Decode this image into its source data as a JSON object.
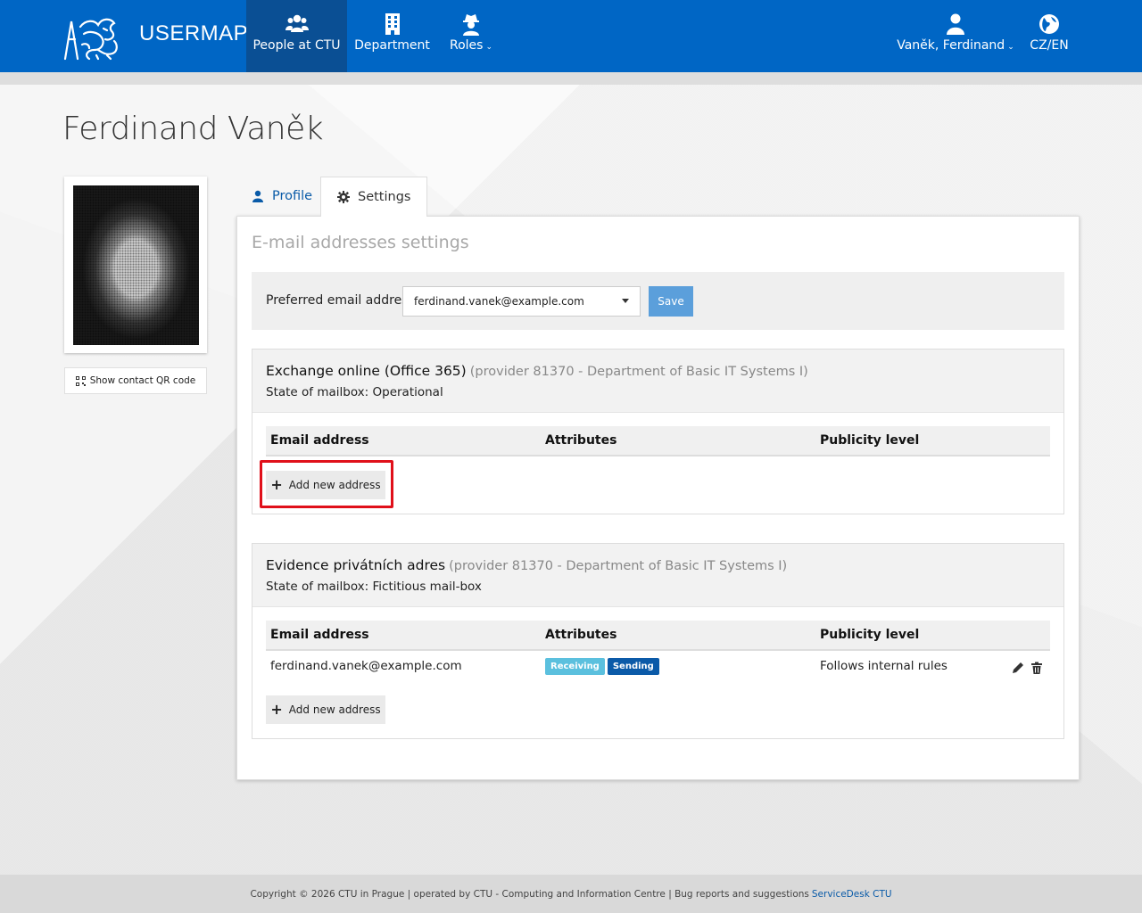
{
  "navbar": {
    "brand": "USERMAP",
    "items": [
      {
        "label": "People at CTU",
        "icon": "users-icon",
        "active": true
      },
      {
        "label": "Department",
        "icon": "building-icon"
      },
      {
        "label": "Roles",
        "icon": "user-secret-icon",
        "caret": "⌄"
      }
    ],
    "user": {
      "label": "Vaněk, Ferdinand",
      "icon": "user-icon",
      "caret": "⌄"
    },
    "language": {
      "label": "CZ/EN",
      "icon": "globe-icon"
    },
    "colors": {
      "bar": "#0066c5",
      "active": "#0a4f94"
    }
  },
  "page": {
    "title": "Ferdinand Vaněk"
  },
  "sidebar": {
    "qr_button": "Show contact QR code"
  },
  "tabs": [
    {
      "label": "Profile",
      "icon": "user-icon"
    },
    {
      "label": "Settings",
      "icon": "gear-icon",
      "active": true
    }
  ],
  "settings": {
    "section_title": "E-mail addresses settings",
    "preferred_label": "Preferred email address:",
    "preferred_value": "ferdinand.vanek@example.com",
    "save_label": "Save"
  },
  "columns": {
    "email": "Email address",
    "attributes": "Attributes",
    "publicity": "Publicity level"
  },
  "mailboxes": [
    {
      "name": "Exchange online (Office 365)",
      "provider": "(provider 81370 - Department of Basic IT Systems I)",
      "state": "State of mailbox: Operational",
      "add_label": "Add new address"
    },
    {
      "name": "Evidence privátních adres",
      "provider": "(provider 81370 - Department of Basic IT Systems I)",
      "state": "State of mailbox: Fictitious mail-box",
      "rows": [
        {
          "email": "ferdinand.vanek@example.com",
          "badges": [
            "Receiving",
            "Sending"
          ],
          "publicity": "Follows internal rules"
        }
      ],
      "add_label": "Add new address"
    }
  ],
  "footer": {
    "text": "Copyright © 2026 CTU in Prague | operated by CTU - Computing and Information Centre | Bug reports and suggestions",
    "link": "ServiceDesk CTU"
  }
}
